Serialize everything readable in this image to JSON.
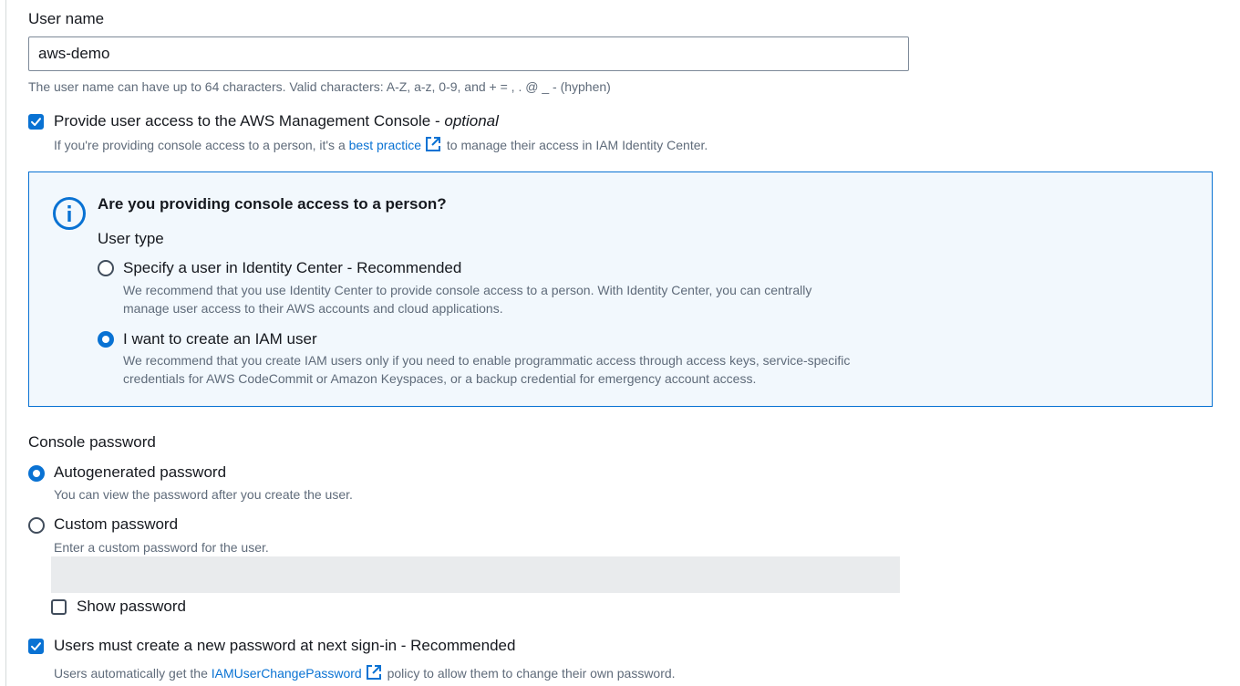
{
  "colors": {
    "accent": "#0972d3",
    "info_bg": "#f2f8fd",
    "muted_text": "#5f6b7a",
    "disabled_bg": "#e9ebed"
  },
  "user_name": {
    "label": "User name",
    "value": "aws-demo",
    "hint": "The user name can have up to 64 characters. Valid characters: A-Z, a-z, 0-9, and + = , . @ _ - (hyphen)"
  },
  "console_access": {
    "checked": true,
    "label": "Provide user access to the AWS Management Console - ",
    "label_optional": "optional",
    "desc_prefix": "If you're providing console access to a person, it's a ",
    "desc_link": "best practice",
    "desc_suffix": " to manage their access in IAM Identity Center."
  },
  "info_panel": {
    "icon": "info-circle-icon",
    "title": "Are you providing console access to a person?",
    "user_type_label": "User type",
    "options": [
      {
        "label": "Specify a user in Identity Center - Recommended",
        "selected": false,
        "desc_line1": "We recommend that you use Identity Center to provide console access to a person. With Identity Center, you can centrally",
        "desc_line2": "manage user access to their AWS accounts and cloud applications."
      },
      {
        "label": "I want to create an IAM user",
        "selected": true,
        "desc_line1": "We recommend that you create IAM users only if you need to enable programmatic access through access keys, service-specific",
        "desc_line2": "credentials for AWS CodeCommit or Amazon Keyspaces, or a backup credential for emergency account access."
      }
    ]
  },
  "console_password": {
    "label": "Console password",
    "options": [
      {
        "label": "Autogenerated password",
        "selected": true,
        "desc": "You can view the password after you create the user."
      },
      {
        "label": "Custom password",
        "selected": false,
        "desc": "Enter a custom password for the user."
      }
    ],
    "custom_password_value": "",
    "show_password": {
      "label": "Show password",
      "checked": false
    }
  },
  "reset_password": {
    "checked": true,
    "label": "Users must create a new password at next sign-in - Recommended",
    "desc_prefix": "Users automatically get the ",
    "desc_link": "IAMUserChangePassword",
    "desc_suffix": " policy to allow them to change their own password."
  }
}
